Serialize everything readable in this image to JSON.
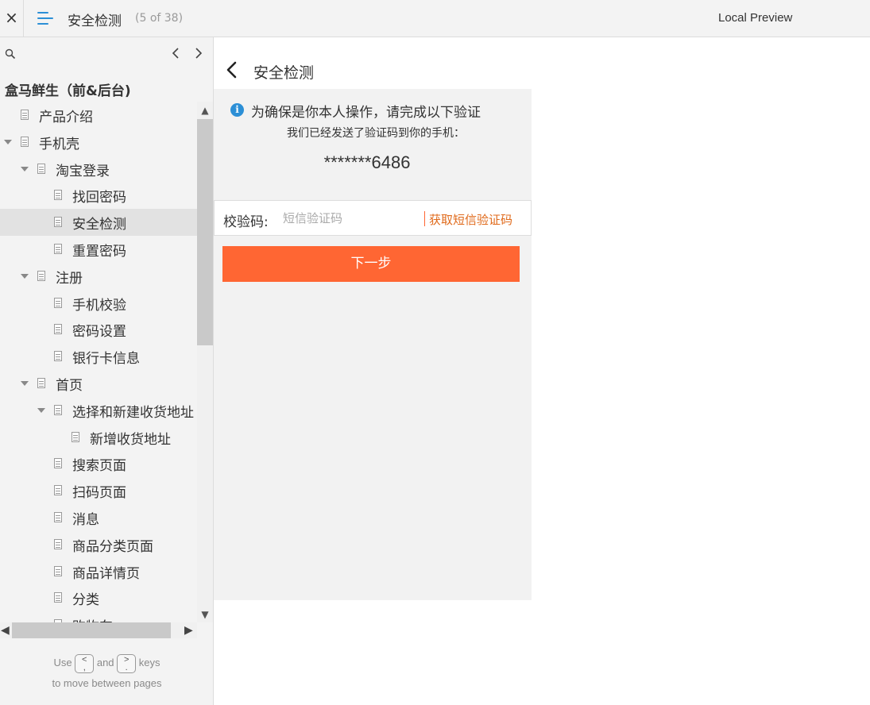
{
  "topbar": {
    "close_glyph": "×",
    "title": "安全检测",
    "page_count": "(5 of 38)",
    "local_preview": "Local Preview"
  },
  "sidebar": {
    "project_title": "盒马鲜生（前&后台)",
    "tree": [
      {
        "label": "产品介绍",
        "level": 0,
        "has_children": false,
        "active": false
      },
      {
        "label": "手机壳",
        "level": 0,
        "has_children": true,
        "active": false
      },
      {
        "label": "淘宝登录",
        "level": 1,
        "has_children": true,
        "active": false
      },
      {
        "label": "找回密码",
        "level": 2,
        "has_children": false,
        "active": false
      },
      {
        "label": "安全检测",
        "level": 2,
        "has_children": false,
        "active": true
      },
      {
        "label": "重置密码",
        "level": 2,
        "has_children": false,
        "active": false
      },
      {
        "label": "注册",
        "level": 1,
        "has_children": true,
        "active": false
      },
      {
        "label": "手机校验",
        "level": 2,
        "has_children": false,
        "active": false
      },
      {
        "label": "密码设置",
        "level": 2,
        "has_children": false,
        "active": false
      },
      {
        "label": "银行卡信息",
        "level": 2,
        "has_children": false,
        "active": false
      },
      {
        "label": "首页",
        "level": 1,
        "has_children": true,
        "active": false
      },
      {
        "label": "选择和新建收货地址",
        "level": 2,
        "has_children": true,
        "active": false
      },
      {
        "label": "新增收货地址",
        "level": 3,
        "has_children": false,
        "active": false
      },
      {
        "label": "搜索页面",
        "level": 2,
        "has_children": false,
        "active": false
      },
      {
        "label": "扫码页面",
        "level": 2,
        "has_children": false,
        "active": false
      },
      {
        "label": "消息",
        "level": 2,
        "has_children": false,
        "active": false
      },
      {
        "label": "商品分类页面",
        "level": 2,
        "has_children": false,
        "active": false
      },
      {
        "label": "商品详情页",
        "level": 2,
        "has_children": false,
        "active": false
      },
      {
        "label": "分类",
        "level": 2,
        "has_children": false,
        "active": false
      },
      {
        "label": "购物车",
        "level": 2,
        "has_children": false,
        "active": false
      }
    ],
    "hint": {
      "use": "Use",
      "prev_key_top": "<",
      "prev_key_bottom": ",",
      "and": "and",
      "next_key_top": ">",
      "next_key_bottom": ".",
      "keys": "keys",
      "line2": "to move between pages"
    }
  },
  "main": {
    "title": "安全检测",
    "info_glyph": "i",
    "verify_title": "为确保是你本人操作，请完成以下验证",
    "verify_sub": "我们已经发送了验证码到你的手机：",
    "masked_phone": "*******6486",
    "code_label": "校验码:",
    "code_placeholder": "短信验证码",
    "get_code": "获取短信验证码",
    "next_button": "下一步"
  },
  "colors": {
    "accent_orange": "#ff6633",
    "link_orange": "#e06a1b",
    "info_blue": "#2c8fd6"
  }
}
